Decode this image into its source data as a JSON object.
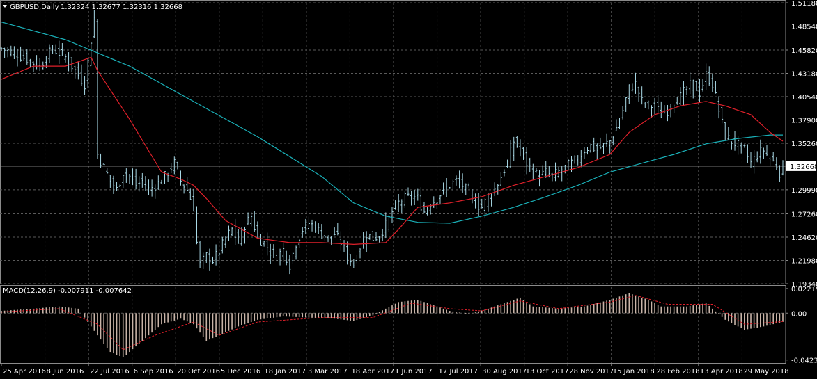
{
  "header": {
    "symbol": "GBPUSD,Daily",
    "ohlc": "1.32324 1.32677 1.32316 1.32668"
  },
  "colors": {
    "background": "#000000",
    "grid": "#5a5a5a",
    "candles": "#a9d9e6",
    "ma_fast": "#e0202a",
    "ma_slow": "#1ab0b8",
    "macd_hist": "#c8b4a8",
    "macd_signal": "#e0202a",
    "price_line": "#9a9a9a"
  },
  "chart_data": [
    {
      "type": "line",
      "title": "GBPUSD,Daily",
      "current_price": "1.32668",
      "y_ticks": [
        "1.51180",
        "1.48540",
        "1.45820",
        "1.43180",
        "1.40540",
        "1.37900",
        "1.35260",
        "1.29990",
        "1.27260",
        "1.24620",
        "1.21980",
        "1.19340"
      ],
      "ylim": [
        1.1934,
        1.5118
      ],
      "x_ticks": [
        "25 Apr 2016",
        "8 Jun 2016",
        "22 Jul 2016",
        "6 Sep 2016",
        "20 Oct 2016",
        "5 Dec 2016",
        "18 Jan 2017",
        "3 Mar 2017",
        "18 Apr 2017",
        "1 Jun 2017",
        "17 Jul 2017",
        "30 Aug 2017",
        "13 Oct 2017",
        "28 Nov 2017",
        "15 Jan 2018",
        "28 Feb 2018",
        "13 Apr 2018",
        "29 May 2018"
      ],
      "close_path": [
        [
          0,
          1.46
        ],
        [
          4,
          1.455
        ],
        [
          8,
          1.448
        ],
        [
          12,
          1.44
        ],
        [
          16,
          1.46
        ],
        [
          20,
          1.45
        ],
        [
          24,
          1.43
        ],
        [
          26,
          1.42
        ],
        [
          28,
          1.47
        ],
        [
          29,
          1.495
        ],
        [
          30,
          1.34
        ],
        [
          32,
          1.325
        ],
        [
          34,
          1.31
        ],
        [
          36,
          1.3
        ],
        [
          38,
          1.32
        ],
        [
          40,
          1.315
        ],
        [
          42,
          1.305
        ],
        [
          44,
          1.31
        ],
        [
          46,
          1.3
        ],
        [
          48,
          1.305
        ],
        [
          50,
          1.31
        ],
        [
          52,
          1.32
        ],
        [
          54,
          1.33
        ],
        [
          56,
          1.31
        ],
        [
          58,
          1.3
        ],
        [
          60,
          1.28
        ],
        [
          61,
          1.24
        ],
        [
          62,
          1.215
        ],
        [
          64,
          1.225
        ],
        [
          66,
          1.22
        ],
        [
          68,
          1.23
        ],
        [
          70,
          1.245
        ],
        [
          72,
          1.255
        ],
        [
          74,
          1.24
        ],
        [
          76,
          1.26
        ],
        [
          78,
          1.27
        ],
        [
          80,
          1.245
        ],
        [
          82,
          1.24
        ],
        [
          84,
          1.23
        ],
        [
          86,
          1.225
        ],
        [
          88,
          1.232
        ],
        [
          90,
          1.215
        ],
        [
          92,
          1.24
        ],
        [
          94,
          1.255
        ],
        [
          96,
          1.262
        ],
        [
          98,
          1.258
        ],
        [
          100,
          1.25
        ],
        [
          102,
          1.245
        ],
        [
          104,
          1.25
        ],
        [
          106,
          1.24
        ],
        [
          108,
          1.225
        ],
        [
          110,
          1.215
        ],
        [
          112,
          1.235
        ],
        [
          114,
          1.25
        ],
        [
          116,
          1.245
        ],
        [
          118,
          1.248
        ],
        [
          120,
          1.26
        ],
        [
          122,
          1.275
        ],
        [
          124,
          1.285
        ],
        [
          126,
          1.29
        ],
        [
          128,
          1.292
        ],
        [
          130,
          1.29
        ],
        [
          132,
          1.275
        ],
        [
          134,
          1.285
        ],
        [
          136,
          1.29
        ],
        [
          138,
          1.3
        ],
        [
          140,
          1.305
        ],
        [
          142,
          1.31
        ],
        [
          144,
          1.305
        ],
        [
          146,
          1.296
        ],
        [
          148,
          1.285
        ],
        [
          150,
          1.28
        ],
        [
          152,
          1.292
        ],
        [
          154,
          1.3
        ],
        [
          156,
          1.315
        ],
        [
          158,
          1.33
        ],
        [
          160,
          1.355
        ],
        [
          162,
          1.345
        ],
        [
          164,
          1.33
        ],
        [
          166,
          1.32
        ],
        [
          168,
          1.315
        ],
        [
          170,
          1.32
        ],
        [
          172,
          1.315
        ],
        [
          174,
          1.32
        ],
        [
          176,
          1.325
        ],
        [
          178,
          1.33
        ],
        [
          180,
          1.335
        ],
        [
          182,
          1.345
        ],
        [
          184,
          1.35
        ],
        [
          186,
          1.345
        ],
        [
          188,
          1.35
        ],
        [
          190,
          1.355
        ],
        [
          192,
          1.37
        ],
        [
          194,
          1.39
        ],
        [
          196,
          1.415
        ],
        [
          198,
          1.42
        ],
        [
          200,
          1.4
        ],
        [
          202,
          1.395
        ],
        [
          204,
          1.395
        ],
        [
          206,
          1.385
        ],
        [
          208,
          1.39
        ],
        [
          210,
          1.4
        ],
        [
          212,
          1.405
        ],
        [
          214,
          1.415
        ],
        [
          216,
          1.42
        ],
        [
          218,
          1.41
        ],
        [
          220,
          1.43
        ],
        [
          222,
          1.42
        ],
        [
          224,
          1.39
        ],
        [
          226,
          1.36
        ],
        [
          228,
          1.355
        ],
        [
          230,
          1.35
        ],
        [
          232,
          1.345
        ],
        [
          234,
          1.33
        ],
        [
          236,
          1.34
        ],
        [
          238,
          1.345
        ],
        [
          240,
          1.335
        ],
        [
          242,
          1.328
        ],
        [
          243,
          1.32
        ],
        [
          244,
          1.3267
        ]
      ],
      "ma_fast_path": [
        [
          0,
          1.425
        ],
        [
          10,
          1.44
        ],
        [
          20,
          1.44
        ],
        [
          28,
          1.45
        ],
        [
          30,
          1.435
        ],
        [
          40,
          1.38
        ],
        [
          50,
          1.32
        ],
        [
          56,
          1.312
        ],
        [
          60,
          1.305
        ],
        [
          64,
          1.29
        ],
        [
          70,
          1.265
        ],
        [
          80,
          1.245
        ],
        [
          90,
          1.24
        ],
        [
          100,
          1.24
        ],
        [
          110,
          1.238
        ],
        [
          120,
          1.24
        ],
        [
          124,
          1.255
        ],
        [
          130,
          1.28
        ],
        [
          140,
          1.285
        ],
        [
          150,
          1.292
        ],
        [
          160,
          1.305
        ],
        [
          170,
          1.315
        ],
        [
          180,
          1.325
        ],
        [
          190,
          1.34
        ],
        [
          196,
          1.365
        ],
        [
          204,
          1.385
        ],
        [
          212,
          1.395
        ],
        [
          220,
          1.4
        ],
        [
          226,
          1.395
        ],
        [
          234,
          1.385
        ],
        [
          240,
          1.365
        ],
        [
          244,
          1.355
        ]
      ],
      "ma_slow_path": [
        [
          0,
          1.49
        ],
        [
          20,
          1.47
        ],
        [
          40,
          1.44
        ],
        [
          60,
          1.4
        ],
        [
          80,
          1.36
        ],
        [
          100,
          1.315
        ],
        [
          110,
          1.285
        ],
        [
          120,
          1.27
        ],
        [
          130,
          1.263
        ],
        [
          140,
          1.262
        ],
        [
          150,
          1.27
        ],
        [
          160,
          1.28
        ],
        [
          170,
          1.292
        ],
        [
          180,
          1.305
        ],
        [
          190,
          1.32
        ],
        [
          200,
          1.33
        ],
        [
          210,
          1.34
        ],
        [
          220,
          1.352
        ],
        [
          230,
          1.358
        ],
        [
          240,
          1.362
        ],
        [
          244,
          1.362
        ]
      ]
    },
    {
      "type": "bar",
      "title": "MACD(12,26,9) -0.007911 -0.007642",
      "y_ticks": [
        "0.02219",
        "0.00",
        "-0.042301"
      ],
      "ylim": [
        -0.045,
        0.024
      ],
      "macd_path": [
        [
          0,
          0.002
        ],
        [
          10,
          0.004
        ],
        [
          18,
          0.006
        ],
        [
          24,
          0.004
        ],
        [
          30,
          -0.02
        ],
        [
          34,
          -0.035
        ],
        [
          38,
          -0.04
        ],
        [
          44,
          -0.025
        ],
        [
          50,
          -0.01
        ],
        [
          56,
          -0.005
        ],
        [
          60,
          -0.01
        ],
        [
          64,
          -0.025
        ],
        [
          68,
          -0.02
        ],
        [
          74,
          -0.012
        ],
        [
          80,
          -0.006
        ],
        [
          88,
          -0.003
        ],
        [
          96,
          -0.004
        ],
        [
          104,
          -0.005
        ],
        [
          110,
          -0.007
        ],
        [
          116,
          -0.002
        ],
        [
          124,
          0.01
        ],
        [
          130,
          0.012
        ],
        [
          136,
          0.006
        ],
        [
          140,
          0.002
        ],
        [
          146,
          -0.001
        ],
        [
          152,
          0.004
        ],
        [
          158,
          0.01
        ],
        [
          162,
          0.014
        ],
        [
          166,
          0.006
        ],
        [
          174,
          0.004
        ],
        [
          182,
          0.006
        ],
        [
          190,
          0.012
        ],
        [
          196,
          0.018
        ],
        [
          202,
          0.012
        ],
        [
          206,
          0.006
        ],
        [
          214,
          0.006
        ],
        [
          220,
          0.009
        ],
        [
          226,
          -0.006
        ],
        [
          232,
          -0.015
        ],
        [
          238,
          -0.012
        ],
        [
          244,
          -0.0079
        ]
      ],
      "signal_path": [
        [
          0,
          0.001
        ],
        [
          18,
          0.004
        ],
        [
          30,
          -0.01
        ],
        [
          38,
          -0.033
        ],
        [
          48,
          -0.02
        ],
        [
          60,
          -0.008
        ],
        [
          68,
          -0.02
        ],
        [
          80,
          -0.008
        ],
        [
          100,
          -0.004
        ],
        [
          116,
          -0.004
        ],
        [
          128,
          0.009
        ],
        [
          140,
          0.004
        ],
        [
          150,
          0.002
        ],
        [
          162,
          0.011
        ],
        [
          174,
          0.004
        ],
        [
          190,
          0.01
        ],
        [
          198,
          0.016
        ],
        [
          208,
          0.008
        ],
        [
          222,
          0.008
        ],
        [
          232,
          -0.01
        ],
        [
          244,
          -0.0076
        ]
      ]
    }
  ]
}
